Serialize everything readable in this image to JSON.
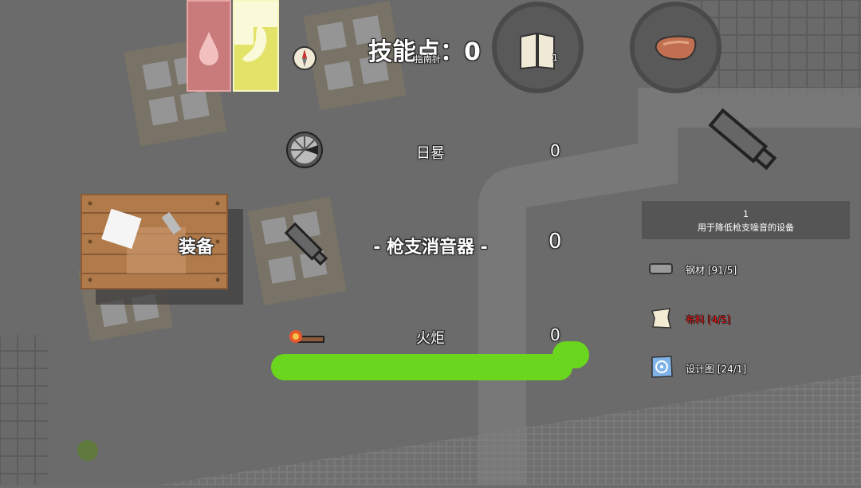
{
  "hud": {
    "skill_points_label": "技能点：0",
    "compass_caption": "指南针",
    "book_count": "1"
  },
  "crafting": {
    "items": [
      {
        "name": "日晷",
        "count": "0",
        "icon": "sundial-icon"
      },
      {
        "name": "- 枪支消音器 -",
        "count": "0",
        "icon": "silencer-icon"
      },
      {
        "name": "火炬",
        "count": "0",
        "icon": "torch-icon"
      }
    ],
    "equipment_label": "装备"
  },
  "detail": {
    "quantity": "1",
    "description": "用于降低枪支噪音的设备",
    "materials": [
      {
        "label": "钢材 [91/5]",
        "color": "#ffffff",
        "icon": "steel-bar-icon"
      },
      {
        "label": "布料 [4/5]",
        "color": "#e01010",
        "icon": "cloth-icon"
      },
      {
        "label": "设计图 [24/1]",
        "color": "#ffffff",
        "icon": "blueprint-icon"
      }
    ]
  },
  "status": {
    "health_color": "#c97a7a",
    "hunger_color": "#e3e36a",
    "progress_color": "#6ad61e"
  }
}
